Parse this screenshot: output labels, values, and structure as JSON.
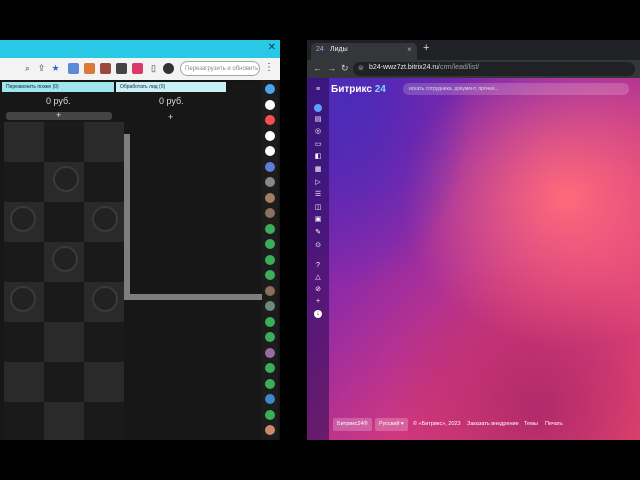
{
  "left_window": {
    "search_placeholder": "Перезагрузить и обновить",
    "menu_dots": "⋮",
    "columns": [
      {
        "title": "Перезвонить позже (0)",
        "sum": "0 руб.",
        "add": "+"
      },
      {
        "title": "Обработать лид (0)",
        "sum": "0 руб.",
        "add": "+"
      }
    ],
    "toolbar_icons": [
      "search-icon",
      "share-icon",
      "lock-icon",
      "star-icon",
      "image-icon",
      "bookmark-icon",
      "extension-icon",
      "puzzle-icon",
      "split-icon",
      "profile-icon"
    ],
    "rail_colors": [
      "#4aa6e8",
      "#ffffff",
      "#ff4d4d",
      "#ffffff",
      "#ffffff",
      "#5c7dd8",
      "#888888",
      "#a47e5e",
      "#8a7060",
      "#3cae5a",
      "#3cae5a",
      "#3cae5a",
      "#3cae5a",
      "#8c6c5a",
      "#6c8a7a",
      "#3cae5a",
      "#3cae5a",
      "#9a6aa0",
      "#3cae5a",
      "#3cae5a",
      "#3c88c8",
      "#3cae5a",
      "#c88a6a",
      "#3cae5a",
      "#3cae5a"
    ],
    "fab": "✕"
  },
  "right_window": {
    "tab": {
      "icon": "24",
      "title": "Лиды",
      "close": "×"
    },
    "new_tab": "+",
    "url_host": "b24-wwz7zt.bitrix24.ru",
    "url_path": "/crm/lead/list/",
    "bitrix": {
      "logo_main": "Битрикс",
      "logo_24": "24",
      "search_placeholder": "искать сотрудника, документ, прочее...",
      "footer": {
        "brand_button": "Битрикс24®",
        "language": "Русский ▾",
        "copyright": "© «Битрикс», 2023",
        "order": "Заказать внедрение",
        "themes": "Темы",
        "print": "Печать"
      }
    }
  }
}
